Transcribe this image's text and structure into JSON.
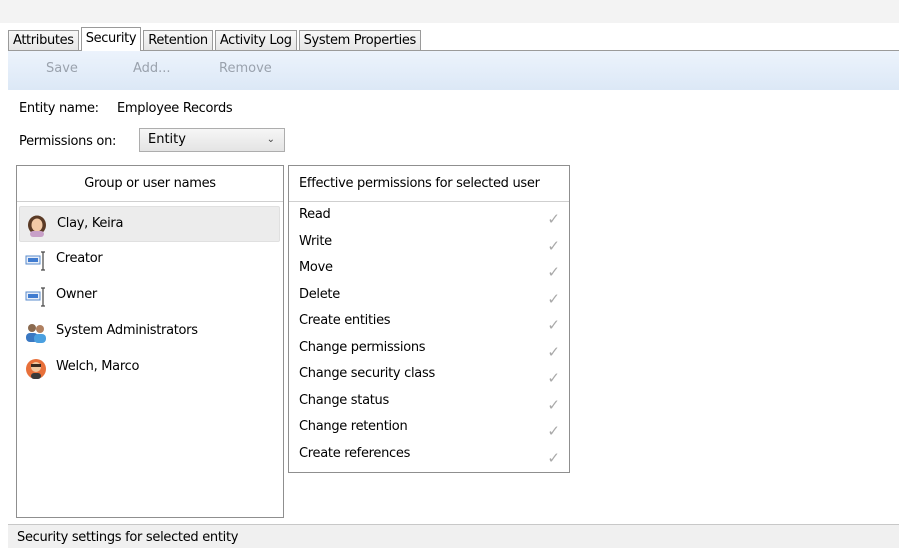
{
  "tabs": [
    {
      "label": "Attributes"
    },
    {
      "label": "Security"
    },
    {
      "label": "Retention"
    },
    {
      "label": "Activity Log"
    },
    {
      "label": "System Properties"
    }
  ],
  "active_tab": "Security",
  "toolbar": {
    "save_label": "Save",
    "add_label": "Add...",
    "remove_label": "Remove"
  },
  "entity": {
    "name_label": "Entity name:",
    "name_value": "Employee Records",
    "permissions_on_label": "Permissions on:",
    "permissions_on_value": "Entity"
  },
  "users_panel": {
    "header": "Group or user names",
    "users": [
      {
        "name": "Clay, Keira",
        "icon": "user-female-icon",
        "selected": true
      },
      {
        "name": "Creator",
        "icon": "role-icon"
      },
      {
        "name": "Owner",
        "icon": "role-icon"
      },
      {
        "name": "System Administrators",
        "icon": "group-icon"
      },
      {
        "name": "Welch, Marco",
        "icon": "user-male-icon"
      }
    ]
  },
  "permissions_panel": {
    "header": "Effective permissions for selected user",
    "permissions": [
      {
        "name": "Read",
        "granted": true
      },
      {
        "name": "Write",
        "granted": true
      },
      {
        "name": "Move",
        "granted": true
      },
      {
        "name": "Delete",
        "granted": true
      },
      {
        "name": "Create entities",
        "granted": true
      },
      {
        "name": "Change permissions",
        "granted": true
      },
      {
        "name": "Change security class",
        "granted": true
      },
      {
        "name": "Change status",
        "granted": true
      },
      {
        "name": "Change retention",
        "granted": true
      },
      {
        "name": "Create references",
        "granted": true
      }
    ],
    "check_glyph": "✓"
  },
  "status_bar": {
    "text": "Security settings for selected entity"
  },
  "colors": {
    "toolbar_top": "#ecf3fc",
    "toolbar_bottom": "#dce8f6",
    "disabled_text": "#9aa2ad",
    "check": "#a9a9a9",
    "selected_row": "#ececec"
  }
}
